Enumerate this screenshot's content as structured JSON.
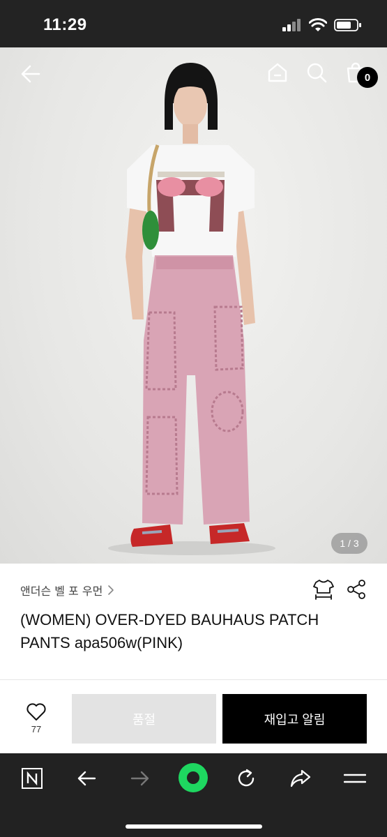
{
  "status_bar": {
    "time": "11:29"
  },
  "product": {
    "brand": "앤더슨 벨 포 우먼",
    "title": "(WOMEN) OVER-DYED BAUHAUS PATCH PANTS apa506w(PINK)",
    "image_pager": "1 / 3",
    "cart_count": "0",
    "like_count": "77"
  },
  "buttons": {
    "sold_out": "품절",
    "restock_alert": "재입고 알림"
  },
  "icons": {
    "back": "arrow-left-icon",
    "home": "home-icon",
    "search": "search-icon",
    "cart": "shopping-bag-icon",
    "size": "shirt-size-icon",
    "share": "share-icon",
    "like": "heart-icon"
  },
  "colors": {
    "primary_button": "#000000",
    "disabled_button": "#e3e3e3",
    "toolbar_bg": "#222222",
    "status_bg": "#232323",
    "accent_green": "#1ed760"
  }
}
